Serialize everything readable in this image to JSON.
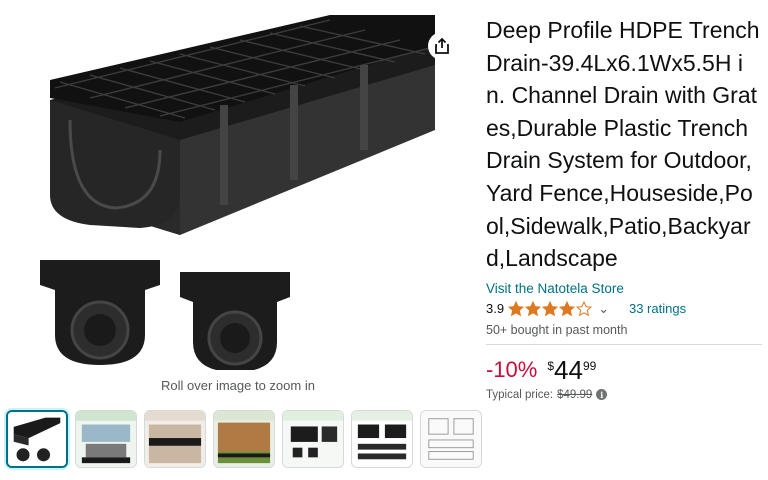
{
  "gallery": {
    "zoom_hint": "Roll over image to zoom in",
    "share_icon": "share-icon",
    "thumbnails": [
      {
        "name": "thumb-product-main",
        "active": true
      },
      {
        "name": "thumb-installation-guide",
        "active": false
      },
      {
        "name": "thumb-driveway-use",
        "active": false
      },
      {
        "name": "thumb-fence-use",
        "active": false
      },
      {
        "name": "thumb-package-contents",
        "active": false
      },
      {
        "name": "thumb-parts-diagram",
        "active": false
      },
      {
        "name": "thumb-dimensions-drawing",
        "active": false
      }
    ]
  },
  "product": {
    "title": "Deep Profile HDPE Trench Drain-39.4Lx6.1Wx5.5H in. Channel Drain with Grates,Durable Plastic Trench Drain System for Outdoor,Yard Fence,Houseside,Pool,Sidewalk,Patio,Backyard,Landscape",
    "store_link": "Visit the Natotela Store",
    "rating_value": "3.9",
    "rating_stars": 3.9,
    "ratings_count": "33 ratings",
    "bought_info": "50+ bought in past month",
    "discount": "-10%",
    "price_symbol": "$",
    "price_whole": "44",
    "price_fraction": "99",
    "typical_label": "Typical price:",
    "typical_price": "$49.99"
  },
  "colors": {
    "link": "#007185",
    "discount": "#cc0c39",
    "star": "#de7921",
    "active_thumb_border": "#007185"
  }
}
